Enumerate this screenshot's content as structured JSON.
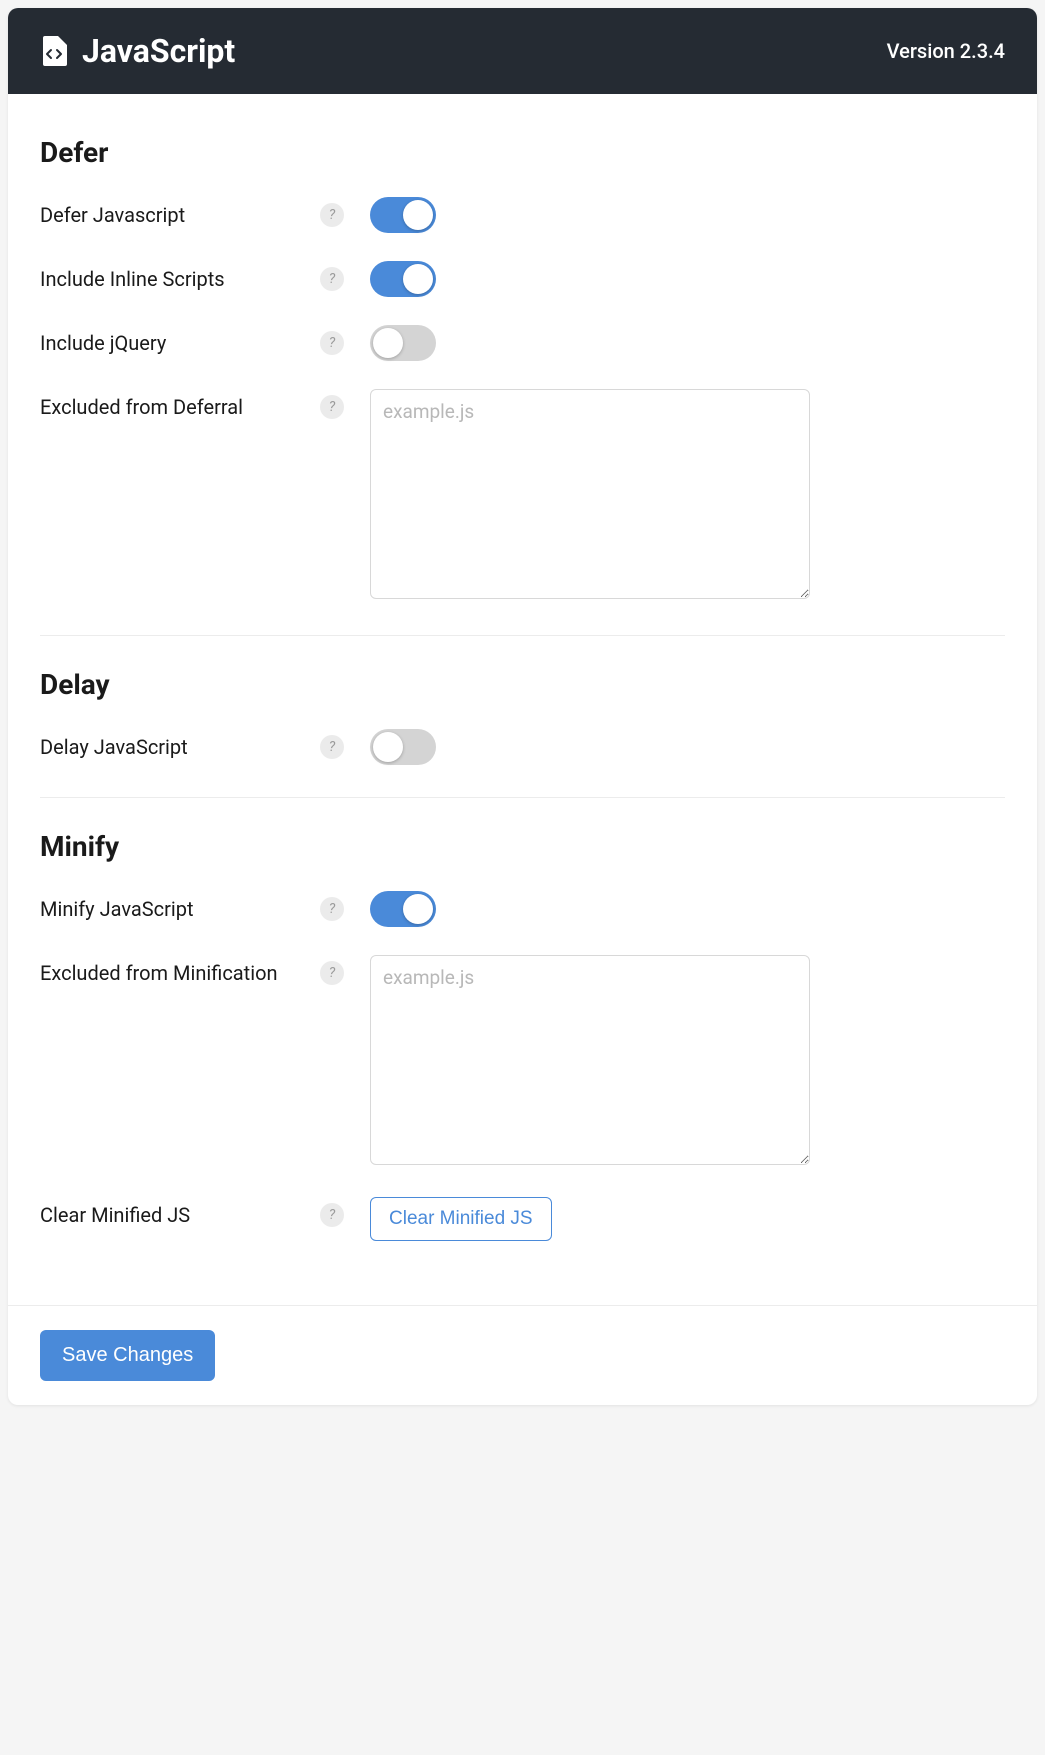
{
  "header": {
    "title": "JavaScript",
    "version": "Version 2.3.4"
  },
  "sections": {
    "defer": {
      "title": "Defer",
      "defer_js": {
        "label": "Defer Javascript",
        "value": true
      },
      "include_inline": {
        "label": "Include Inline Scripts",
        "value": true
      },
      "include_jquery": {
        "label": "Include jQuery",
        "value": false
      },
      "excluded": {
        "label": "Excluded from Deferral",
        "placeholder": "example.js",
        "value": ""
      }
    },
    "delay": {
      "title": "Delay",
      "delay_js": {
        "label": "Delay JavaScript",
        "value": false
      }
    },
    "minify": {
      "title": "Minify",
      "minify_js": {
        "label": "Minify JavaScript",
        "value": true
      },
      "excluded": {
        "label": "Excluded from Minification",
        "placeholder": "example.js",
        "value": ""
      },
      "clear": {
        "label": "Clear Minified JS",
        "button": "Clear Minified JS"
      }
    }
  },
  "footer": {
    "save": "Save Changes"
  },
  "help_glyph": "?"
}
